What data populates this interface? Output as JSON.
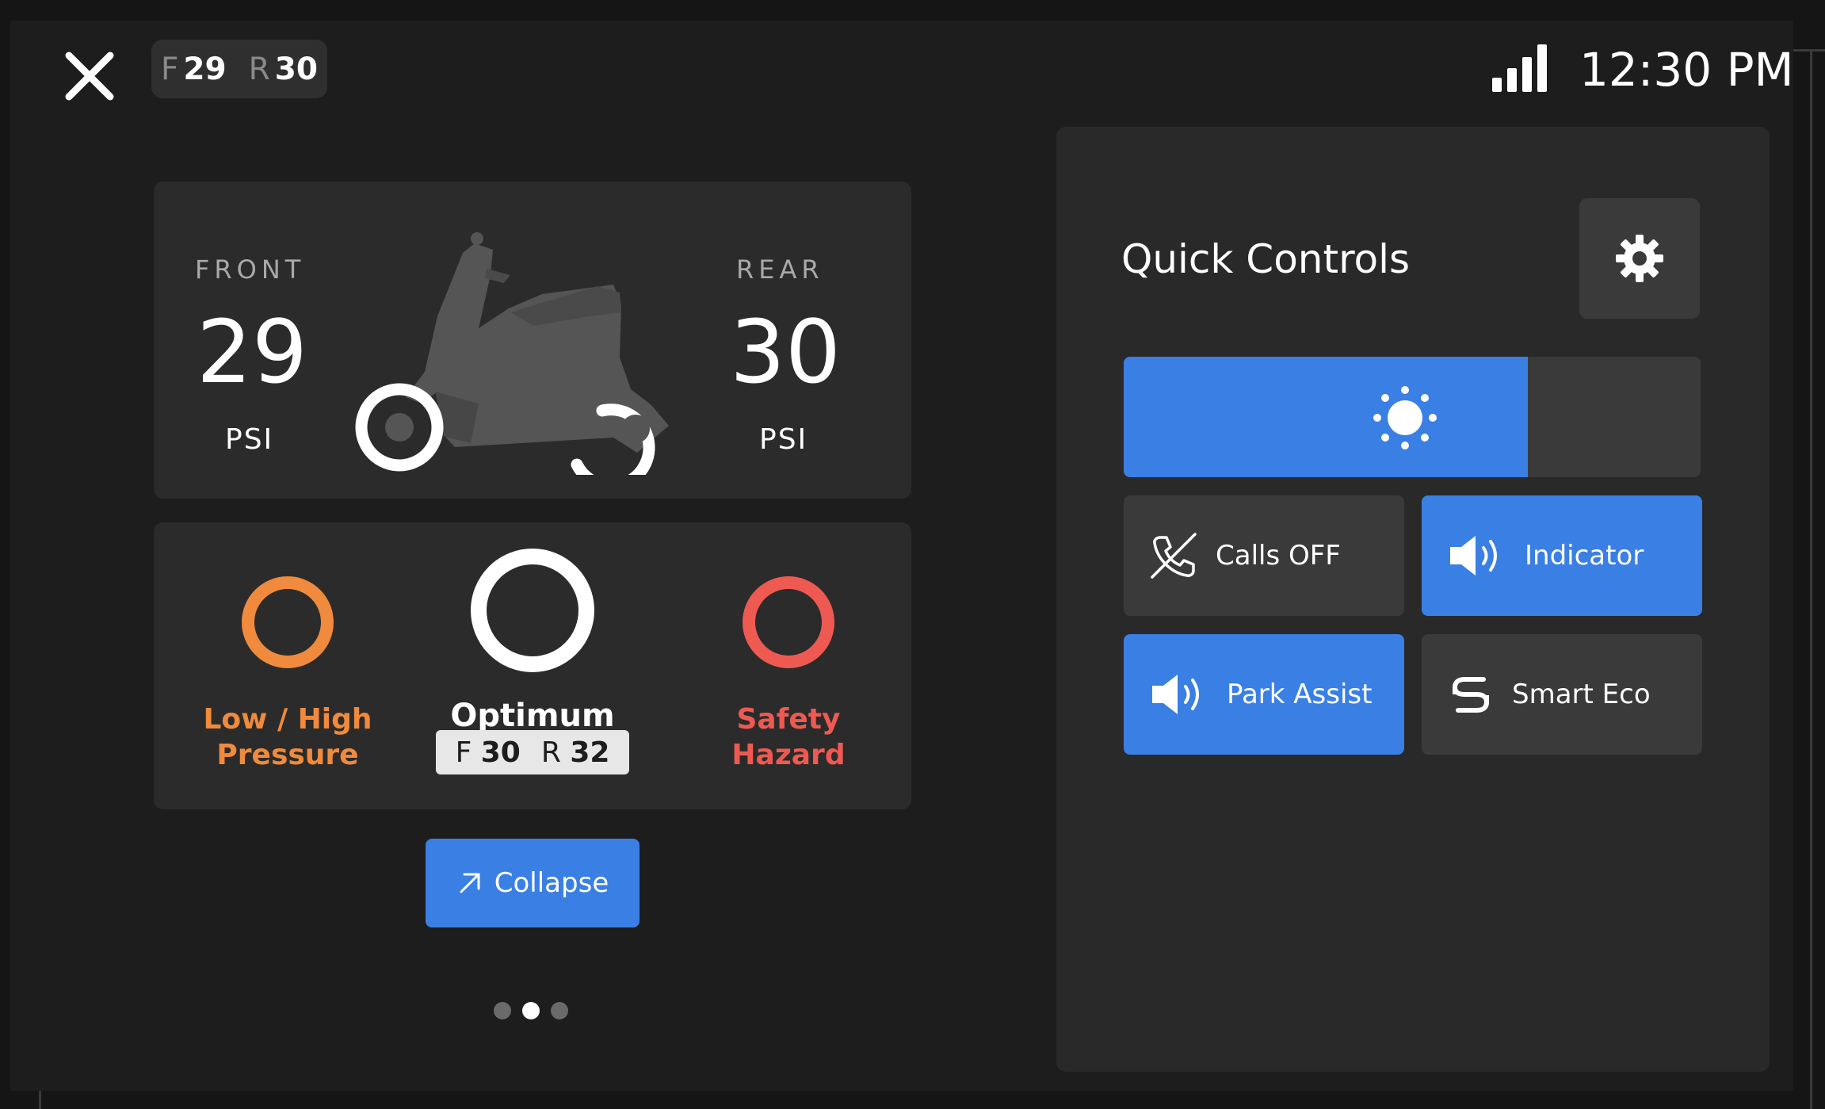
{
  "topbar": {
    "pressure_pill": {
      "front_label": "F",
      "front_value": "29",
      "rear_label": "R",
      "rear_value": "30"
    },
    "time": "12:30 PM"
  },
  "tyre_card": {
    "front": {
      "label": "FRONT",
      "value": "29",
      "unit": "PSI"
    },
    "rear": {
      "label": "REAR",
      "value": "30",
      "unit": "PSI"
    }
  },
  "status_card": {
    "low_high": {
      "line1": "Low / High",
      "line2": "Pressure",
      "color": "#f08a3c"
    },
    "optimum": {
      "label": "Optimum",
      "front_label": "F",
      "front_value": "30",
      "rear_label": "R",
      "rear_value": "32",
      "color": "#ffffff"
    },
    "hazard": {
      "line1": "Safety",
      "line2": "Hazard",
      "color": "#ee5a52"
    }
  },
  "collapse_button": {
    "label": "Collapse",
    "icon": "arrow-up-right-icon"
  },
  "pagination": {
    "total": 3,
    "active_index": 1
  },
  "quick_controls": {
    "title": "Quick Controls",
    "brightness_level": 0.7,
    "tiles": [
      {
        "label": "Calls OFF",
        "icon": "phone-off-icon",
        "active": false
      },
      {
        "label": "Indicator",
        "icon": "speaker-icon",
        "active": true
      },
      {
        "label": "Park Assist",
        "icon": "speaker-icon",
        "active": true
      },
      {
        "label": "Smart Eco",
        "icon": "smart-eco-icon",
        "active": false
      }
    ]
  },
  "colors": {
    "accent": "#3a7fe4",
    "warning": "#f08a3c",
    "danger": "#ee5a52",
    "card": "#2b2b2b",
    "background": "#1d1d1d"
  }
}
